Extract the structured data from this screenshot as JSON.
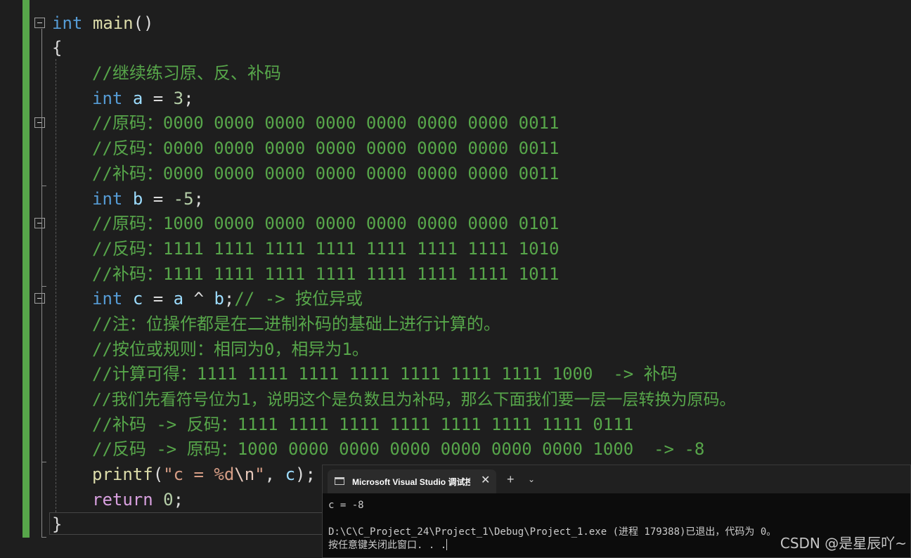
{
  "editor": {
    "line1": {
      "kw": "int",
      "fn": "main",
      "parens": "()"
    },
    "line2": {
      "brace": "{"
    },
    "line3": {
      "comment": "//继续练习原、反、补码"
    },
    "line4": {
      "kw": "int",
      "var": "a",
      "eq": " = ",
      "num": "3",
      "semi": ";"
    },
    "line5": {
      "comment": "//原码：0000 0000 0000 0000 0000 0000 0000 0011"
    },
    "line6": {
      "comment": "//反码：0000 0000 0000 0000 0000 0000 0000 0011"
    },
    "line7": {
      "comment": "//补码：0000 0000 0000 0000 0000 0000 0000 0011"
    },
    "line8": {
      "kw": "int",
      "var": "b",
      "eq": " = ",
      "num": "-5",
      "semi": ";"
    },
    "line9": {
      "comment": "//原码：1000 0000 0000 0000 0000 0000 0000 0101"
    },
    "line10": {
      "comment": "//反码：1111 1111 1111 1111 1111 1111 1111 1010"
    },
    "line11": {
      "comment": "//补码：1111 1111 1111 1111 1111 1111 1111 1011"
    },
    "line12": {
      "kw": "int",
      "var_c": "c",
      "eq": " = ",
      "var_a": "a",
      "op": " ^ ",
      "var_b": "b",
      "semi": ";",
      "comment": "// -> 按位异或"
    },
    "line13": {
      "comment": "//注：位操作都是在二进制补码的基础上进行计算的。"
    },
    "line14": {
      "comment": "//按位或规则：相同为0，相异为1。"
    },
    "line15": {
      "comment": "//计算可得：1111 1111 1111 1111 1111 1111 1111 1000  -> 补码"
    },
    "line16": {
      "comment": "//我们先看符号位为1，说明这个是负数且为补码，那么下面我们要一层一层转换为原码。"
    },
    "line17": {
      "comment": "//补码 -> 反码：1111 1111 1111 1111 1111 1111 1111 0111"
    },
    "line18": {
      "comment": "//反码 -> 原码：1000 0000 0000 0000 0000 0000 0000 1000  -> -8"
    },
    "line19": {
      "fn": "printf",
      "open": "(",
      "str1": "\"c = %d",
      "esc": "\\n",
      "str2": "\"",
      "comma": ", ",
      "var": "c",
      "close": ");"
    },
    "line20": {
      "kw": "return",
      "num": "0",
      "semi": ";"
    },
    "line21": {
      "brace": "}"
    }
  },
  "console": {
    "tab_title": "Microsoft Visual Studio 调试控制台",
    "close_glyph": "✕",
    "new_tab_glyph": "+",
    "dropdown_glyph": "⌄",
    "lines": [
      "c = -8",
      "",
      "D:\\C\\C_Project_24\\Project_1\\Debug\\Project_1.exe (进程 179388)已退出，代码为 0。",
      "按任意键关闭此窗口. . ."
    ]
  },
  "watermark": "CSDN @是星辰吖~",
  "colors": {
    "background": "#1e1e1e",
    "keyword": "#569cd6",
    "comment": "#57a64a",
    "function": "#dcdcaa",
    "variable": "#9cdcfe",
    "number": "#b5cea8",
    "string": "#d69d85",
    "change_bar": "#57a64a"
  }
}
